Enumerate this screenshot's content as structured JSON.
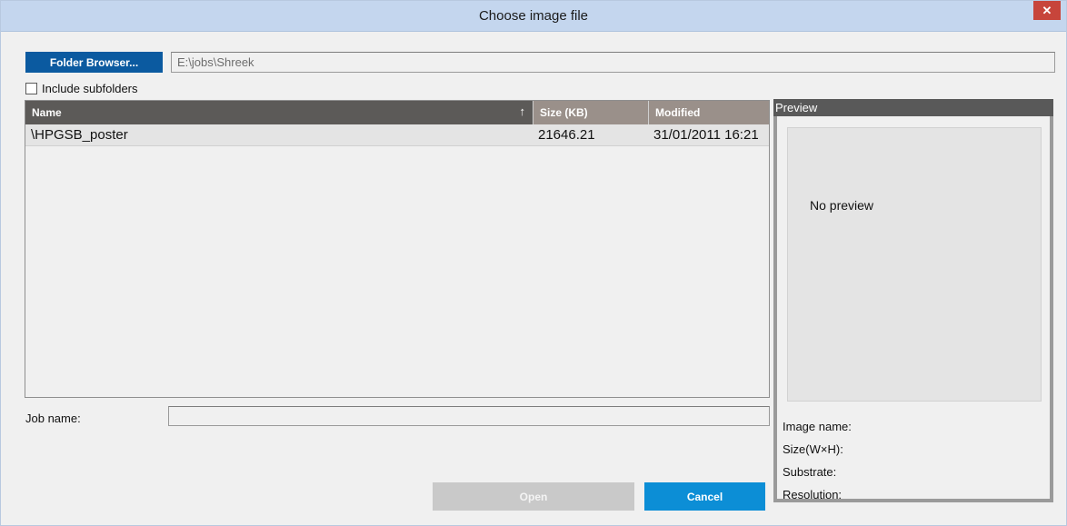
{
  "window": {
    "title": "Choose image file",
    "close_glyph": "✕"
  },
  "toolbar": {
    "folder_browser_label": "Folder Browser...",
    "path_value": "E:\\jobs\\Shreek"
  },
  "options": {
    "include_subfolders_label": "Include subfolders",
    "include_subfolders_checked": false
  },
  "file_list": {
    "columns": {
      "name": "Name",
      "size": "Size (KB)",
      "modified": "Modified"
    },
    "sort_glyph": "↑",
    "rows": [
      {
        "name": "\\HPGSB_poster",
        "size": "21646.21",
        "modified": "31/01/2011 16:21"
      }
    ]
  },
  "job": {
    "label": "Job name:",
    "value": ""
  },
  "buttons": {
    "open_label": "Open",
    "cancel_label": "Cancel"
  },
  "preview": {
    "header": "Preview",
    "placeholder": "No preview",
    "image_name_label": "Image name:",
    "size_label": "Size(W×H):",
    "substrate_label": "Substrate:",
    "resolution_label": "Resolution:"
  },
  "colors": {
    "accent_blue": "#0b5aa0",
    "cancel_blue": "#0c8ed6",
    "close_red": "#c7453b",
    "titlebar": "#c4d6ee"
  },
  "icons": [
    "close-icon",
    "sort-ascending-icon",
    "checkbox-icon"
  ]
}
